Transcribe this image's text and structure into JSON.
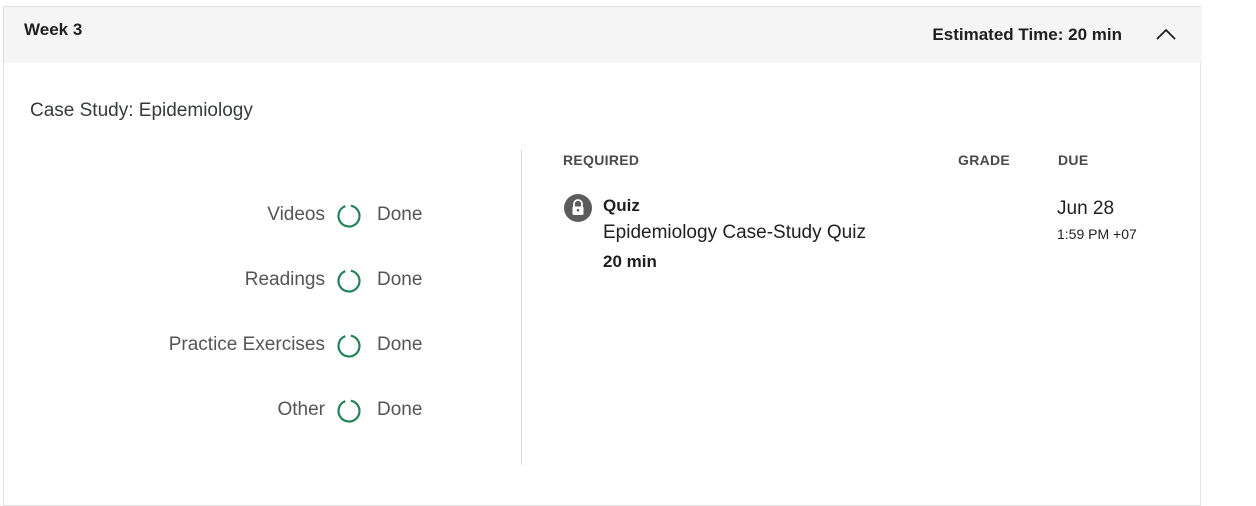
{
  "week": {
    "title": "Week 3",
    "estimated_time": "Estimated Time: 20 min"
  },
  "lesson": {
    "title": "Case Study: Epidemiology"
  },
  "progress": [
    {
      "label": "Videos",
      "status": "Done"
    },
    {
      "label": "Readings",
      "status": "Done"
    },
    {
      "label": "Practice Exercises",
      "status": "Done"
    },
    {
      "label": "Other",
      "status": "Done"
    }
  ],
  "table": {
    "headers": {
      "required": "REQUIRED",
      "grade": "GRADE",
      "due": "DUE"
    },
    "items": [
      {
        "type": "Quiz",
        "name": "Epidemiology Case-Study Quiz",
        "duration": "20 min",
        "grade": "",
        "due_date": "Jun 28",
        "due_time": "1:59 PM +07",
        "icon": "lock-icon"
      }
    ]
  },
  "colors": {
    "header_bg": "#f5f5f5",
    "progress_ring": "#1f8354",
    "lock_bg": "#5c5c5c"
  }
}
